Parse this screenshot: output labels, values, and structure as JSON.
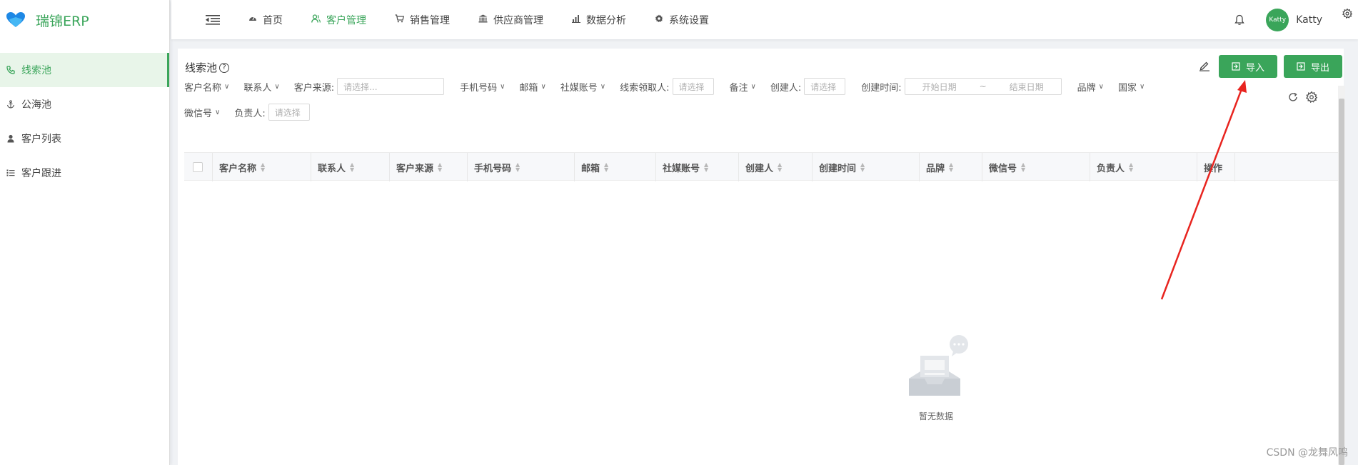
{
  "brand": {
    "name": "瑞锦ERP"
  },
  "sidebar": {
    "items": [
      {
        "label": "线索池",
        "icon": "phone-icon",
        "active": true
      },
      {
        "label": "公海池",
        "icon": "anchor-icon",
        "active": false
      },
      {
        "label": "客户列表",
        "icon": "user-icon",
        "active": false
      },
      {
        "label": "客户跟进",
        "icon": "list-icon",
        "active": false
      }
    ]
  },
  "topnav": {
    "items": [
      {
        "label": "首页",
        "icon": "dashboard-icon"
      },
      {
        "label": "客户管理",
        "icon": "users-icon",
        "active": true
      },
      {
        "label": "销售管理",
        "icon": "cart-icon"
      },
      {
        "label": "供应商管理",
        "icon": "bank-icon"
      },
      {
        "label": "数据分析",
        "icon": "bar-chart-icon"
      },
      {
        "label": "系统设置",
        "icon": "gear-icon"
      }
    ],
    "user": {
      "avatar_text": "Katty",
      "name": "Katty"
    }
  },
  "panel": {
    "title": "线索池",
    "import_label": "导入",
    "export_label": "导出"
  },
  "filters": {
    "customer_name": "客户名称",
    "contact": "联系人",
    "source_label": "客户来源:",
    "source_placeholder": "请选择...",
    "phone": "手机号码",
    "email": "邮箱",
    "social": "社媒账号",
    "claimer_label": "线索领取人:",
    "claimer_placeholder": "请选择",
    "remark": "备注",
    "creator_label": "创建人:",
    "creator_placeholder": "请选择",
    "created_time_label": "创建时间:",
    "start_date": "开始日期",
    "range_sep": "~",
    "end_date": "结束日期",
    "brand": "品牌",
    "country": "国家",
    "wechat": "微信号",
    "owner_label": "负责人:",
    "owner_placeholder": "请选择"
  },
  "table": {
    "columns": [
      "客户名称",
      "联系人",
      "客户来源",
      "手机号码",
      "邮箱",
      "社媒账号",
      "创建人",
      "创建时间",
      "品牌",
      "微信号",
      "负责人",
      "操作"
    ],
    "empty_text": "暂无数据"
  },
  "watermark": "CSDN @龙舞风鸣",
  "colors": {
    "primary": "#3aa55a",
    "annotation_arrow": "#e8241f"
  }
}
